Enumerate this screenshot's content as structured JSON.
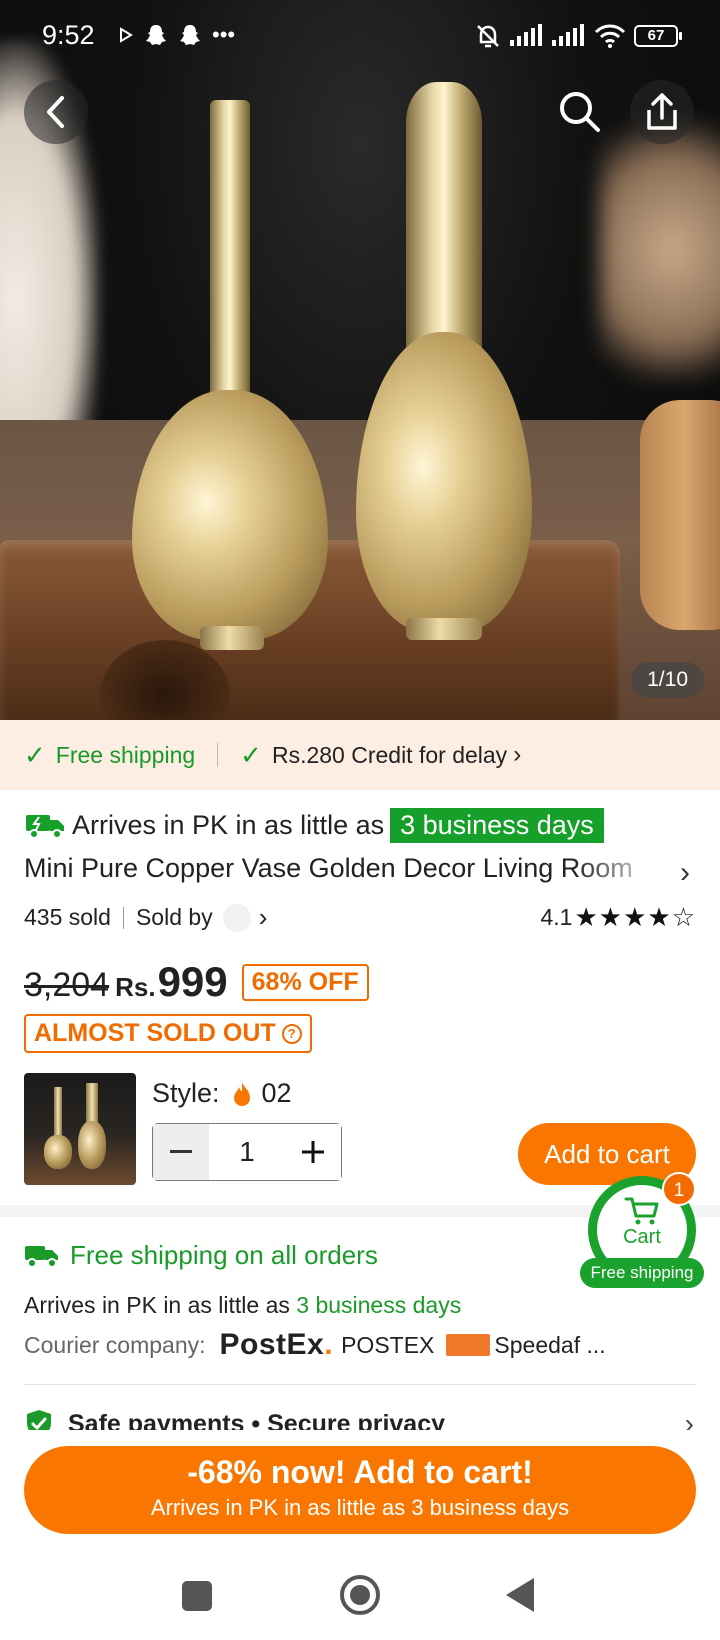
{
  "status_bar": {
    "time": "9:52",
    "battery": "67"
  },
  "gallery": {
    "counter": "1/10"
  },
  "shipping_band": {
    "free_shipping": "Free shipping",
    "credit": "Rs.280 Credit for delay"
  },
  "product": {
    "arrive_prefix": "Arrives in PK in as little as",
    "arrive_highlight": "3 business days",
    "title": "Mini Pure Copper Vase Golden Decor Living Room",
    "sold": "435 sold",
    "sold_by": "Sold by",
    "rating": "4.1",
    "stars": "★★★★☆",
    "old_price": "3,204",
    "currency": "Rs.",
    "price": "999",
    "discount": "68% OFF",
    "almost_sold_out": "ALMOST SOLD OUT",
    "style_label": "Style:",
    "style_value": "02",
    "quantity": "1",
    "add_to_cart": "Add to cart"
  },
  "float_cart": {
    "label": "Cart",
    "badge": "1",
    "free_shipping": "Free shipping"
  },
  "shipping_info": {
    "free_all": "Free shipping on all orders",
    "arrive_prefix": "Arrives in PK in as little as",
    "arrive_days": "3 business days",
    "courier_label": "Courier company:",
    "postex_logo": "PostEx",
    "postex_name": "POSTEX",
    "speedaf_name": "Speedaf ...",
    "safe": "Safe payments • Secure privacy"
  },
  "cta": {
    "line1": "-68% now! Add to cart!",
    "line2": "Arrives in PK in as little as 3 business days"
  },
  "colors": {
    "accent_orange": "#f97700",
    "green": "#1a9a29",
    "band_bg": "#fdeee4"
  }
}
